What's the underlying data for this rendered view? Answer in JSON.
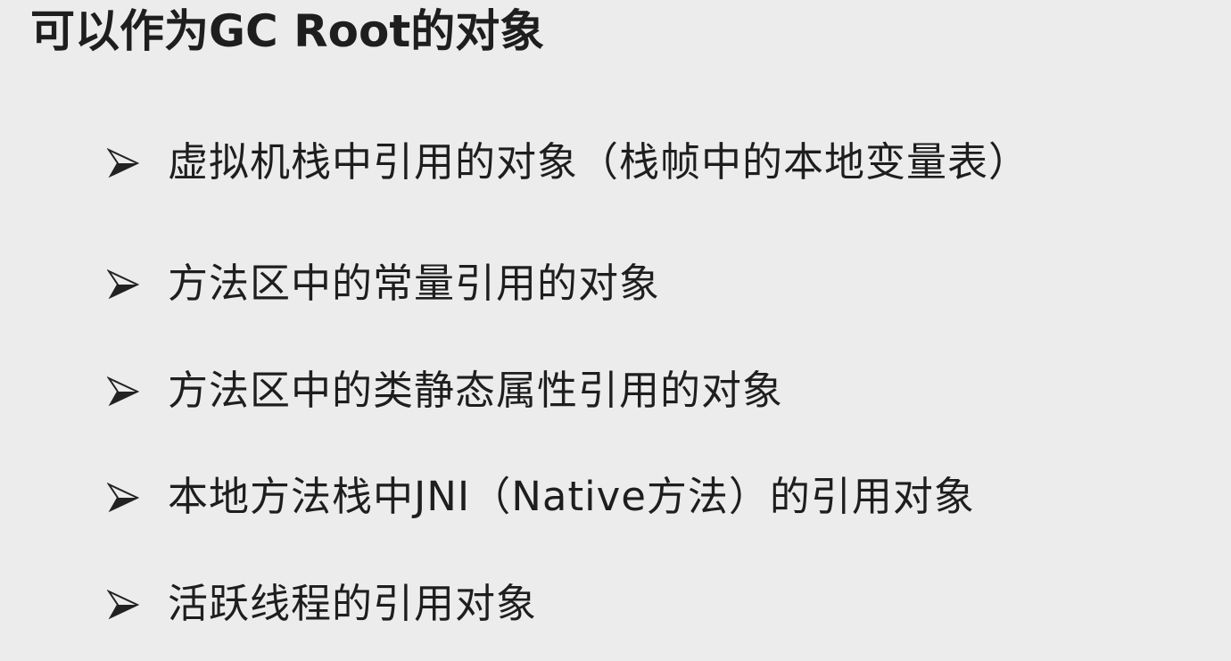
{
  "slide": {
    "title": "可以作为GC Root的对象",
    "bullet_icon": "arrowhead-bullet-icon",
    "items": [
      {
        "text": "虚拟机栈中引用的对象（栈帧中的本地变量表）"
      },
      {
        "text": "方法区中的常量引用的对象"
      },
      {
        "text": "方法区中的类静态属性引用的对象"
      },
      {
        "text": "本地方法栈中JNI（Native方法）的引用对象"
      },
      {
        "text": "活跃线程的引用对象"
      }
    ]
  },
  "colors": {
    "background": "#ececec",
    "text": "#1e1e1e"
  }
}
